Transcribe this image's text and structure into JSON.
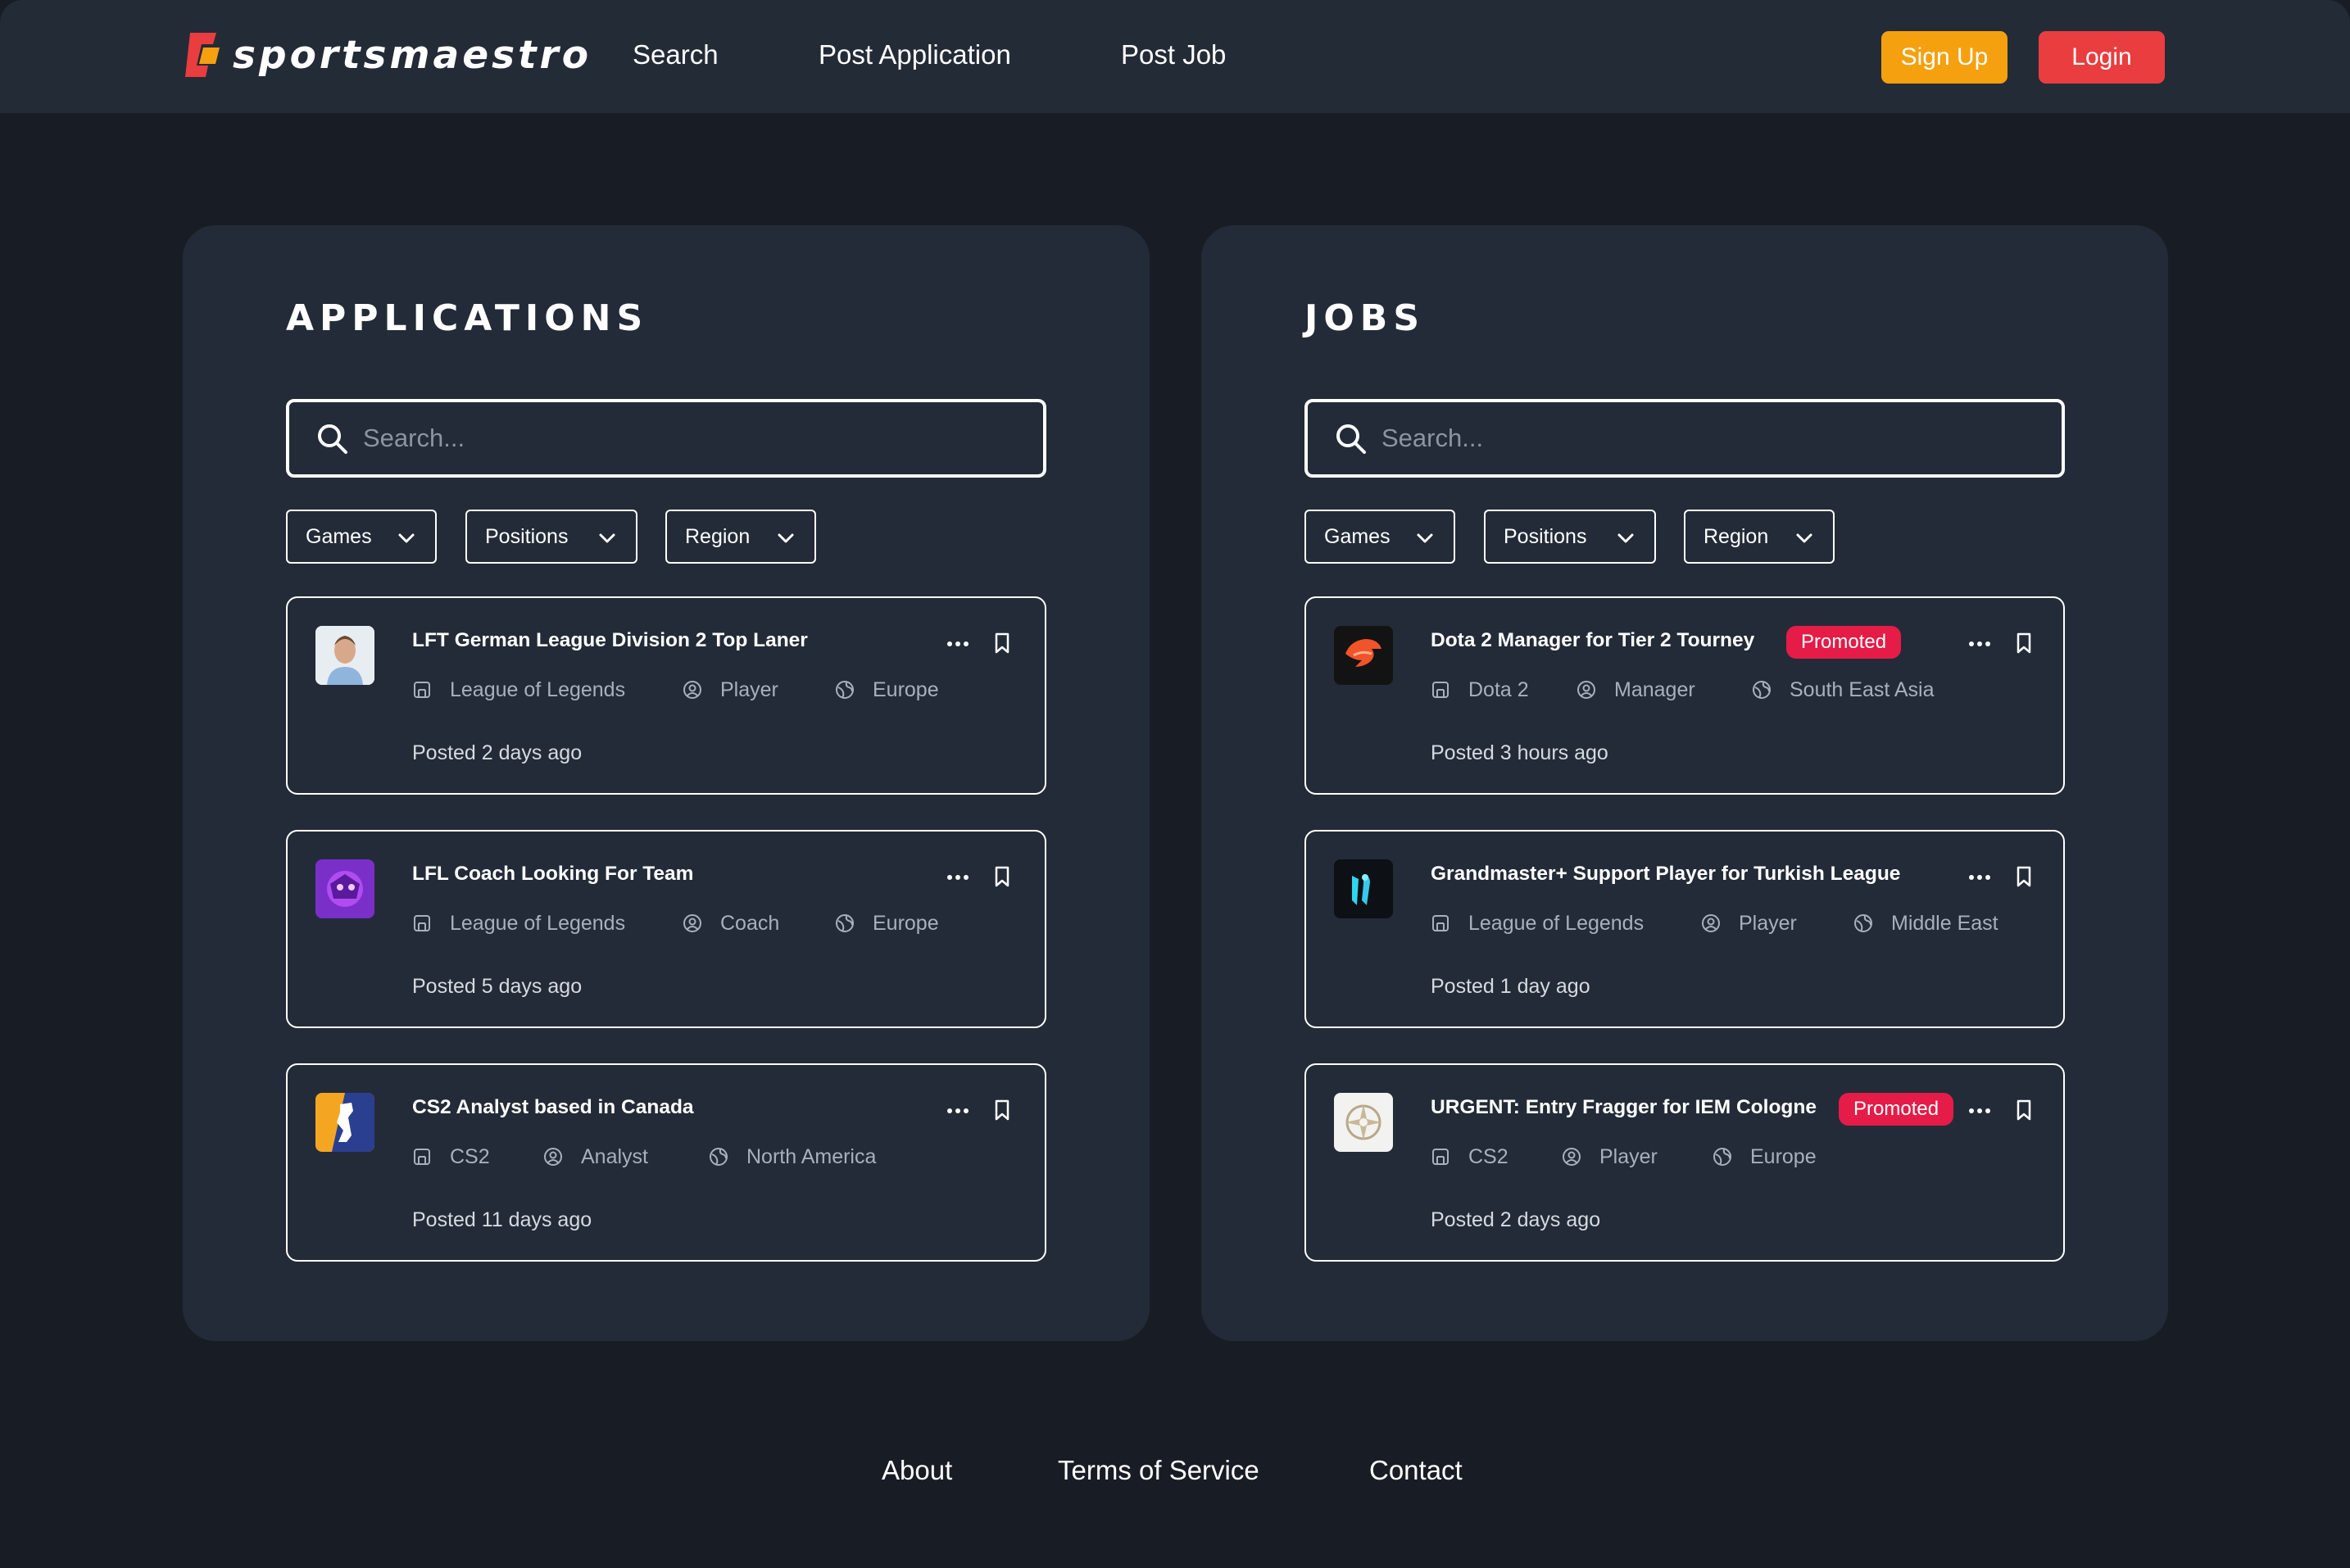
{
  "brand": {
    "name": "sportsmaestro",
    "colors": {
      "primary": "#ea3d3f",
      "secondary": "#f5a00f",
      "promoted": "#e41c47"
    }
  },
  "nav": {
    "links": [
      "Search",
      "Post Application",
      "Post Job"
    ],
    "signup": "Sign Up",
    "login": "Login"
  },
  "applications": {
    "title": "APPLICATIONS",
    "search_placeholder": "Search...",
    "filters": [
      "Games",
      "Positions",
      "Region"
    ],
    "cards": [
      {
        "title": "LFT German League Division 2 Top Laner",
        "game": "League of Legends",
        "role": "Player",
        "region": "Europe",
        "posted": "Posted 2 days ago",
        "logo": "player-avatar"
      },
      {
        "title": "LFL Coach Looking For Team",
        "game": "League of Legends",
        "role": "Coach",
        "region": "Europe",
        "posted": "Posted 5 days ago",
        "logo": "purple-avatar"
      },
      {
        "title": "CS2 Analyst based in Canada",
        "game": "CS2",
        "role": "Analyst",
        "region": "North America",
        "posted": "Posted 11 days ago",
        "logo": "cs2-logo"
      }
    ]
  },
  "jobs": {
    "title": "JOBS",
    "search_placeholder": "Search...",
    "filters": [
      "Games",
      "Positions",
      "Region"
    ],
    "cards": [
      {
        "title": "Dota 2 Manager for Tier 2 Tourney",
        "badge": "Promoted",
        "game": "Dota 2",
        "role": "Manager",
        "region": "South East Asia",
        "posted": "Posted 3 hours ago",
        "logo": "phoenix-logo"
      },
      {
        "title": "Grandmaster+ Support Player for Turkish League",
        "game": "League of Legends",
        "role": "Player",
        "region": "Middle East",
        "posted": "Posted 1 day ago",
        "logo": "cyan-logo"
      },
      {
        "title": "URGENT: Entry Fragger for IEM Cologne",
        "badge": "Promoted",
        "game": "CS2",
        "role": "Player",
        "region": "Europe",
        "posted": "Posted 2 days ago",
        "logo": "ninjas-logo"
      }
    ]
  },
  "footer": {
    "links": [
      "About",
      "Terms of Service",
      "Contact"
    ]
  }
}
